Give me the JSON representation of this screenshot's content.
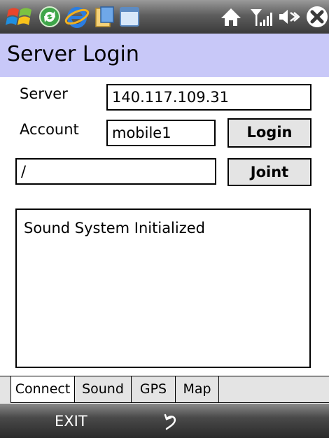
{
  "statusbar": {
    "icons": [
      "windows-start-icon",
      "sync-icon",
      "internet-explorer-icon",
      "folder-icon",
      "window-icon",
      "home-icon",
      "signal-strength-icon",
      "volume-icon",
      "close-icon"
    ]
  },
  "title": "Server Login",
  "form": {
    "server_label": "Server",
    "server_value": "140.117.109.31",
    "account_label": "Account",
    "account_value": "mobile1",
    "login_button": "Login",
    "path_value": "/",
    "joint_button": "Joint"
  },
  "log_text": "Sound System Initialized",
  "tabs": [
    {
      "label": "Connect",
      "active": true
    },
    {
      "label": "Sound",
      "active": false
    },
    {
      "label": "GPS",
      "active": false
    },
    {
      "label": "Map",
      "active": false
    }
  ],
  "softkeys": {
    "left": "EXIT",
    "center_icon": "back-arrow-icon"
  },
  "colors": {
    "title_bg": "#c8c8f8",
    "statusbar": "#4a4a4a",
    "button_bg": "#e4e4e4"
  }
}
